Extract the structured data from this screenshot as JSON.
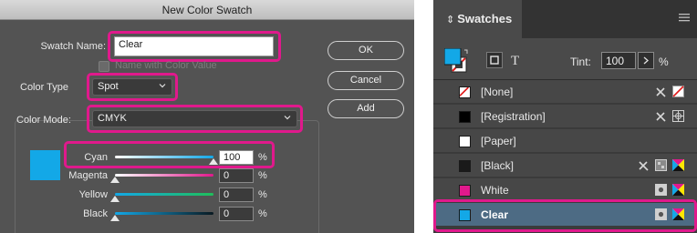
{
  "dialog": {
    "title": "New Color Swatch",
    "swatch_name_label": "Swatch Name:",
    "swatch_name_value": "Clear",
    "name_with_value_label": "Name with Color Value",
    "color_type_label": "Color Type",
    "color_type_value": "Spot",
    "color_mode_label": "Color Mode:",
    "color_mode_value": "CMYK",
    "buttons": {
      "ok": "OK",
      "cancel": "Cancel",
      "add": "Add"
    },
    "preview_color": "#13a8e7",
    "channels": [
      {
        "name": "Cyan",
        "value": "100",
        "unit": "%",
        "level": 1.0
      },
      {
        "name": "Magenta",
        "value": "0",
        "unit": "%",
        "level": 0.0
      },
      {
        "name": "Yellow",
        "value": "0",
        "unit": "%",
        "level": 0.0
      },
      {
        "name": "Black",
        "value": "0",
        "unit": "%",
        "level": 0.0
      }
    ],
    "highlight_color": "#e0198c"
  },
  "swatches_panel": {
    "title": "Swatches",
    "tint_label": "Tint:",
    "tint_value": "100",
    "tint_unit": "%",
    "rows": [
      {
        "label": "[None]",
        "color": "#ffffff",
        "icons": [
          "no-edit-icon",
          "none-icon"
        ]
      },
      {
        "label": "[Registration]",
        "color": "#000000",
        "icons": [
          "no-edit-icon",
          "registration-icon"
        ]
      },
      {
        "label": "[Paper]",
        "color": "#ffffff",
        "icons": []
      },
      {
        "label": "[Black]",
        "color": "#1a1a1a",
        "icons": [
          "no-edit-icon",
          "process-icon",
          "cmyk-icon"
        ]
      },
      {
        "label": "White",
        "color": "#e0198c",
        "icons": [
          "spot-icon",
          "cmyk-icon"
        ]
      },
      {
        "label": "Clear",
        "color": "#13a8e7",
        "icons": [
          "spot-icon",
          "cmyk-icon"
        ]
      }
    ]
  }
}
